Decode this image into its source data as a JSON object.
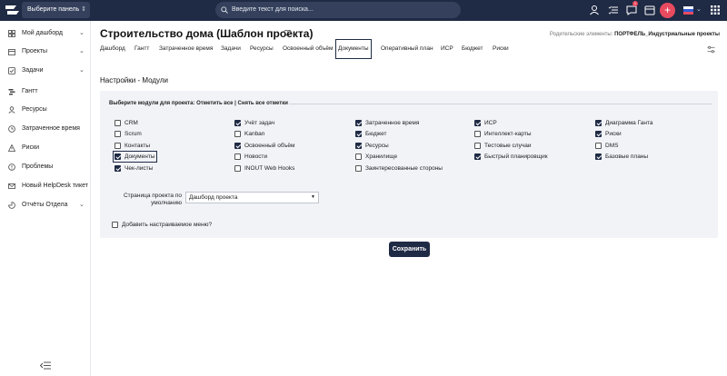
{
  "topbar": {
    "panel_select": "Выберите панель",
    "search_placeholder": "Введите текст для поиска...",
    "notifications_badge": "1"
  },
  "sidebar": {
    "items": [
      {
        "label": "Мой дашборд",
        "icon": "dashboard-icon",
        "has_arrow": true
      },
      {
        "label": "Проекты",
        "icon": "projects-icon",
        "has_arrow": true
      },
      {
        "label": "Задачи",
        "icon": "tasks-icon",
        "has_arrow": true
      },
      {
        "label": "Гантт",
        "icon": "gantt-icon",
        "has_arrow": false
      },
      {
        "label": "Ресурсы",
        "icon": "resources-icon",
        "has_arrow": false
      },
      {
        "label": "Затраченное время",
        "icon": "clock-icon",
        "has_arrow": false
      },
      {
        "label": "Риски",
        "icon": "risks-icon",
        "has_arrow": false
      },
      {
        "label": "Проблемы",
        "icon": "problems-icon",
        "has_arrow": false
      },
      {
        "label": "Новый HelpDesk тикет",
        "icon": "helpdesk-icon",
        "has_arrow": false
      },
      {
        "label": "Отчёты Отдела",
        "icon": "reports-icon",
        "has_arrow": true
      }
    ]
  },
  "header": {
    "title": "Строительство дома (Шаблон проекта)",
    "parent_label": "Родительские элементы:",
    "parent_value": "ПОРТФЕЛЬ_Индустриальные проекты"
  },
  "tabs": [
    {
      "label": "Дашборд",
      "active": false
    },
    {
      "label": "Гантт",
      "active": false
    },
    {
      "label": "Затраченное время",
      "active": false
    },
    {
      "label": "Задачи",
      "active": false
    },
    {
      "label": "Ресурсы",
      "active": false
    },
    {
      "label": "Освоенный объём",
      "active": false
    },
    {
      "label": "Документы",
      "active": true
    },
    {
      "label": "Оперативный план",
      "active": false
    },
    {
      "label": "ИСР",
      "active": false
    },
    {
      "label": "Бюджет",
      "active": false
    },
    {
      "label": "Риски",
      "active": false
    }
  ],
  "settings": {
    "title": "Настройки - Модули",
    "modules_head": "Выберите модули для проекта: Отметить все | Снять все отметки",
    "modules": [
      [
        {
          "label": "CRM",
          "checked": false
        },
        {
          "label": "Scrum",
          "checked": false
        },
        {
          "label": "Контакты",
          "checked": false
        },
        {
          "label": "Документы",
          "checked": true
        },
        {
          "label": "Чек-листы",
          "checked": true
        }
      ],
      [
        {
          "label": "Учёт задач",
          "checked": true
        },
        {
          "label": "Kanban",
          "checked": false
        },
        {
          "label": "Освоенный объём",
          "checked": true
        },
        {
          "label": "Новости",
          "checked": false
        },
        {
          "label": "INOUT Web Hooks",
          "checked": false
        }
      ],
      [
        {
          "label": "Затраченное время",
          "checked": true
        },
        {
          "label": "Бюджет",
          "checked": true
        },
        {
          "label": "Ресурсы",
          "checked": true
        },
        {
          "label": "Хранилище",
          "checked": false
        },
        {
          "label": "Заинтересованные стороны",
          "checked": false
        }
      ],
      [
        {
          "label": "ИСР",
          "checked": true
        },
        {
          "label": "Интеллект-карты",
          "checked": false
        },
        {
          "label": "Тестовые случаи",
          "checked": false
        },
        {
          "label": "Быстрый планировщик",
          "checked": true
        }
      ],
      [
        {
          "label": "Диаграмма Ганта",
          "checked": true
        },
        {
          "label": "Риски",
          "checked": true
        },
        {
          "label": "DMS",
          "checked": false
        },
        {
          "label": "Базовые планы",
          "checked": true
        }
      ]
    ],
    "start_page_label": "Страница проекта по умолчанию",
    "start_page_value": "Дашборд проекта",
    "custom_menu_label": "Добавить настраиваемое меню?",
    "custom_menu_checked": false,
    "save_label": "Сохранить"
  },
  "colors": {
    "navy": "#1f2a44",
    "accent_red": "#e84a5f"
  }
}
